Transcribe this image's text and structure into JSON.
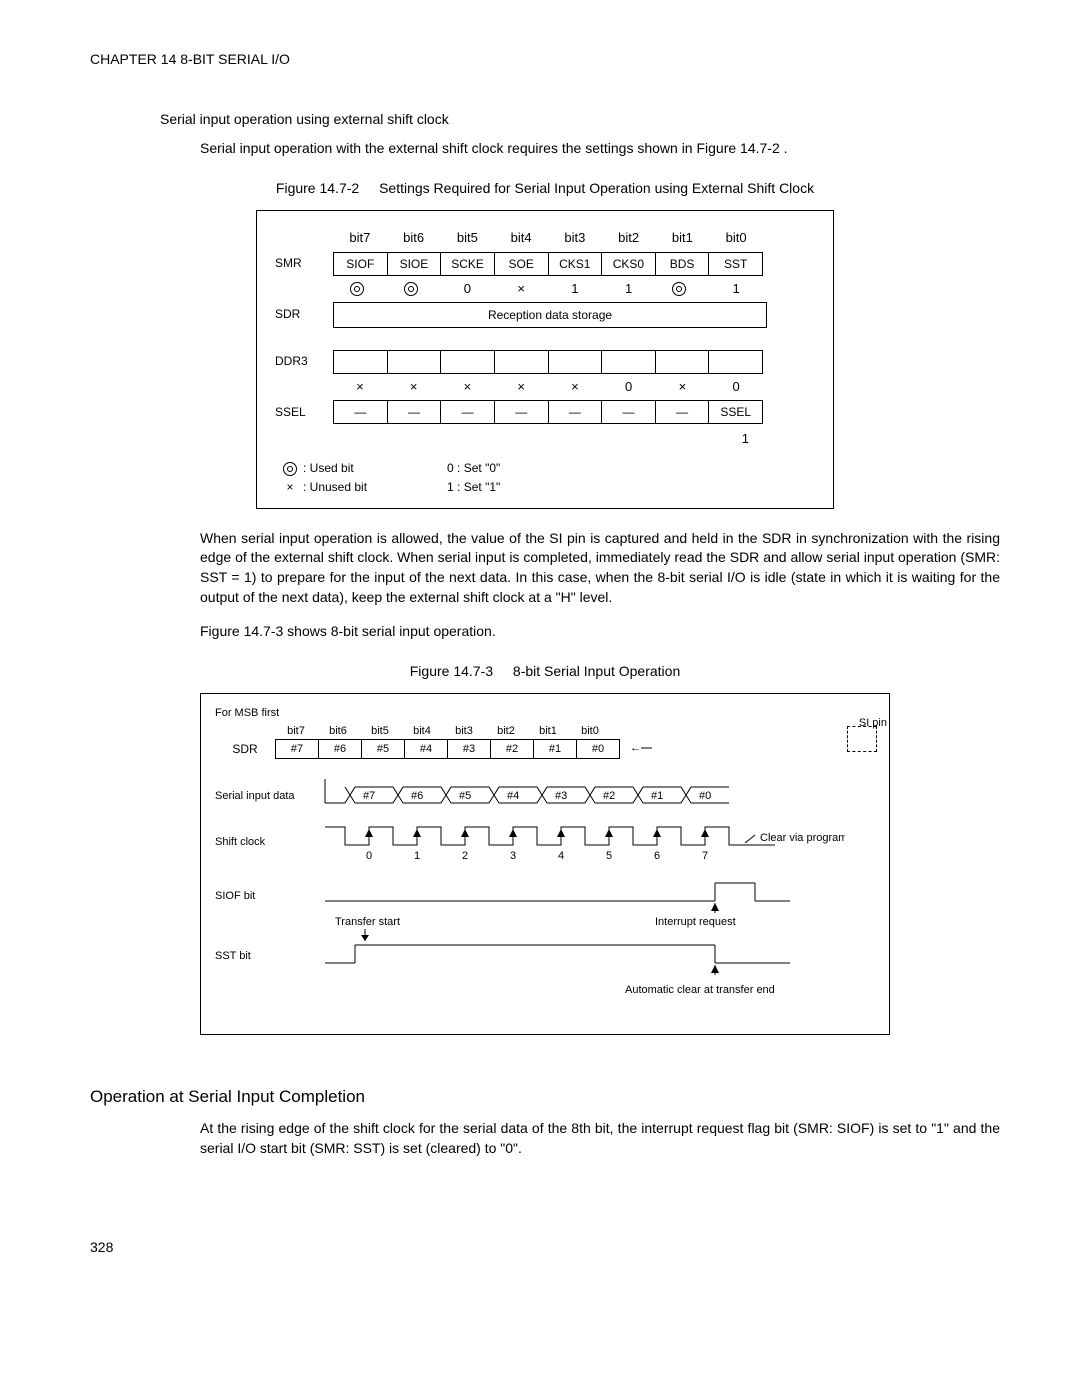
{
  "chapter_header": "CHAPTER 14  8-BIT SERIAL I/O",
  "section1_title": "Serial input operation using external shift clock",
  "section1_body": "Serial input operation with the external shift clock requires the settings shown in Figure 14.7-2 .",
  "fig1_num": "Figure 14.7-2",
  "fig1_title": "Settings Required for Serial   Input Operation using External Shift Clock",
  "reg": {
    "bit_headers": [
      "bit7",
      "bit6",
      "bit5",
      "bit4",
      "bit3",
      "bit2",
      "bit1",
      "bit0"
    ],
    "smr_label": "SMR",
    "smr_cells": [
      "SIOF",
      "SIOE",
      "SCKE",
      "SOE",
      "CKS1",
      "CKS0",
      "BDS",
      "SST"
    ],
    "smr_vals": [
      "◎",
      "◎",
      "0",
      "×",
      "1",
      "1",
      "◎",
      "1"
    ],
    "sdr_label": "SDR",
    "sdr_text": "Reception data storage",
    "ddr3_label": "DDR3",
    "ddr3_vals": [
      "×",
      "×",
      "×",
      "×",
      "×",
      "0",
      "×",
      "0"
    ],
    "ssel_label": "SSEL",
    "ssel_cells": [
      "—",
      "—",
      "—",
      "—",
      "—",
      "—",
      "—",
      "SSEL"
    ],
    "ssel_valr": "1",
    "legend": {
      "used": ":  Used bit",
      "unused": ":  Unused bit",
      "set0": "0   :  Set \"0\"",
      "set1": "1   :  Set \"1\""
    }
  },
  "para1": "When serial input operation is allowed, the value of the SI pin is captured and held in the SDR in synchronization with the rising edge of the external shift clock. When serial input is completed, immediately read the SDR and allow serial input operation (SMR: SST = 1) to prepare for the input of the next data. In this case, when the 8-bit serial I/O is idle (state in which it is waiting for the output of the next data), keep the external shift clock at a \"H\" level.",
  "para2": "Figure 14.7-3 shows 8-bit serial input operation.",
  "fig2_num": "Figure 14.7-3",
  "fig2_title": "8-bit Serial Input Operation",
  "timing": {
    "msb": "For MSB first",
    "bit_headers": [
      "bit7",
      "bit6",
      "bit5",
      "bit4",
      "bit3",
      "bit2",
      "bit1",
      "bit0"
    ],
    "sdr_label": "SDR",
    "sdr_cells": [
      "#7",
      "#6",
      "#5",
      "#4",
      "#3",
      "#2",
      "#1",
      "#0"
    ],
    "si_pin": "SI pin",
    "row_input_label": "Serial input data",
    "input_bits": [
      "#7",
      "#6",
      "#5",
      "#4",
      "#3",
      "#2",
      "#1",
      "#0"
    ],
    "row_clock_label": "Shift clock",
    "clock_nums": [
      "0",
      "1",
      "2",
      "3",
      "4",
      "5",
      "6",
      "7"
    ],
    "clear_label": "Clear via program",
    "siof_label": "SIOF bit",
    "transfer_start": "Transfer start",
    "interrupt": "Interrupt request",
    "sst_label": "SST bit",
    "auto_clear": "Automatic clear at transfer end"
  },
  "section2_title": "Operation at Serial   Input Completion",
  "section2_body": "At the rising edge of the shift clock for the serial data of the 8th bit, the interrupt request flag bit (SMR: SIOF) is set to \"1\" and the serial I/O start bit (SMR: SST) is set (cleared) to \"0\".",
  "page_number": "328"
}
